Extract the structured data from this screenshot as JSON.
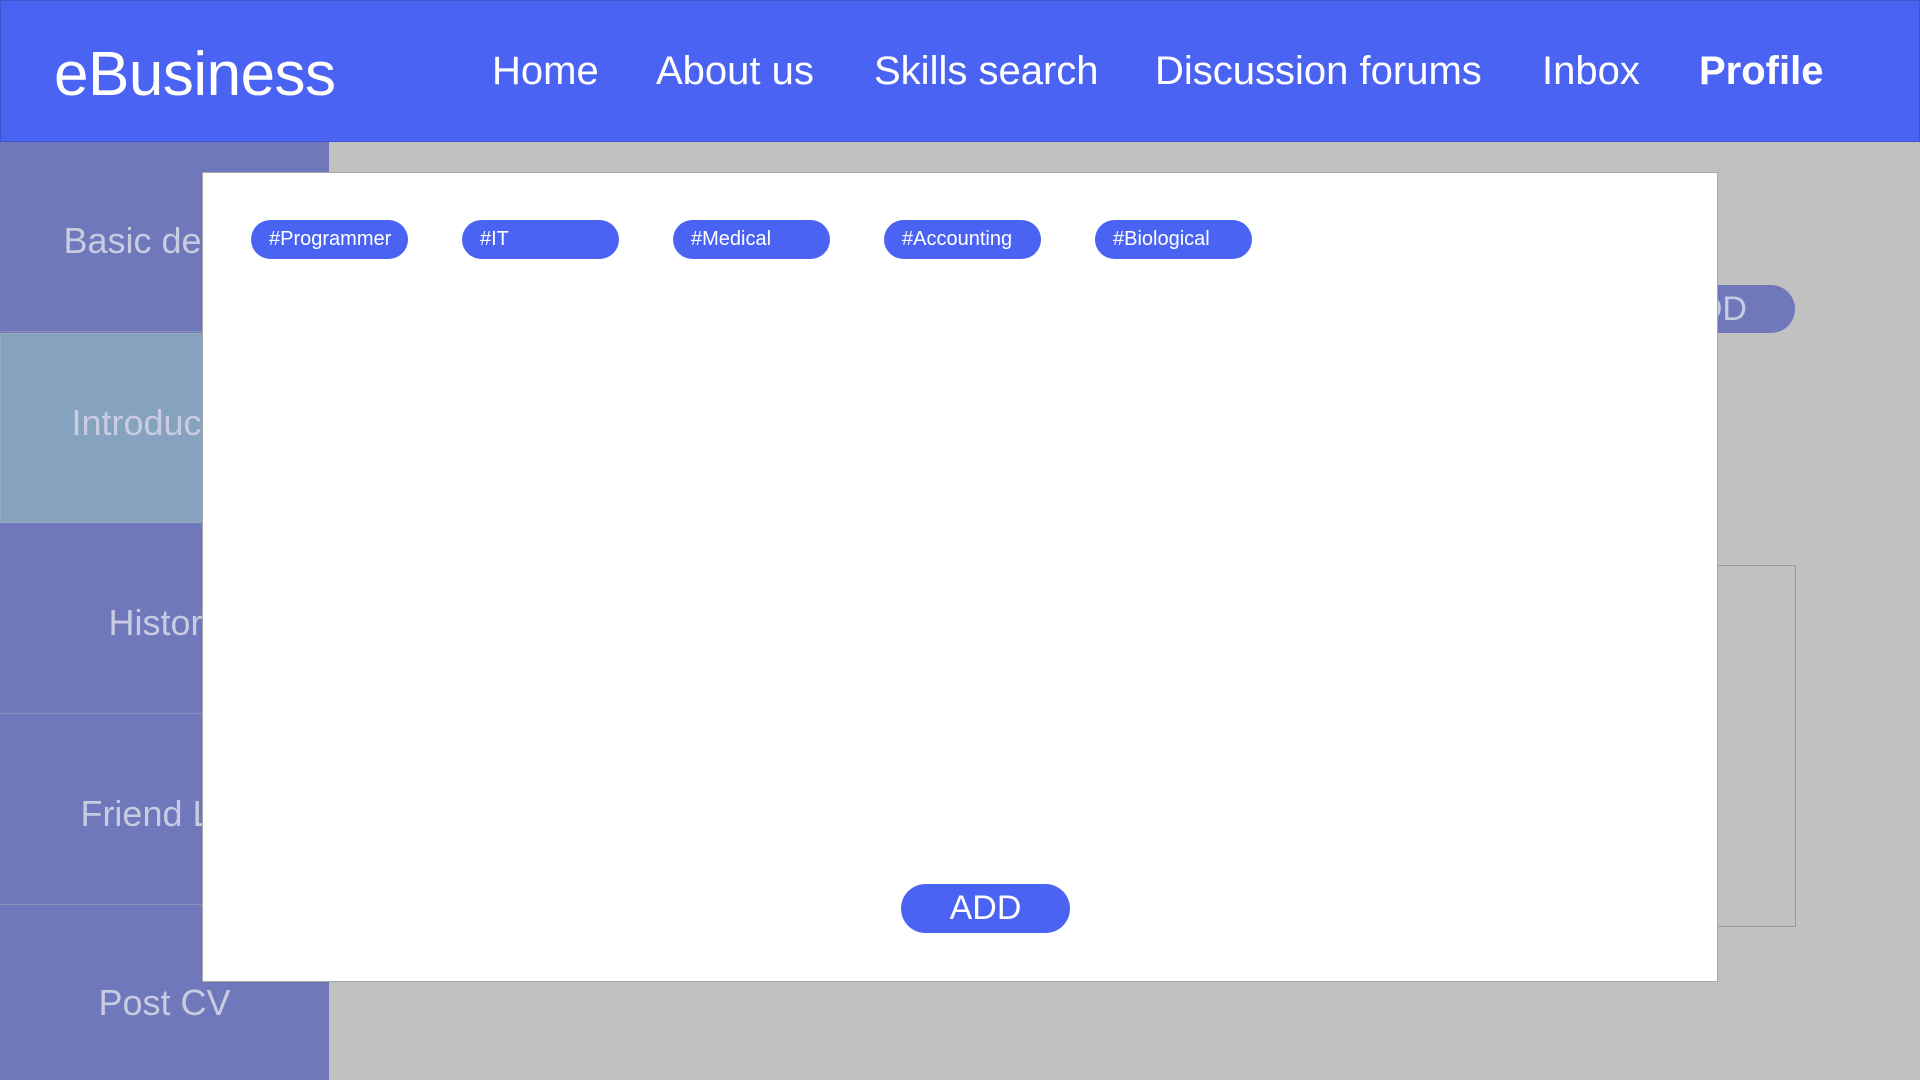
{
  "header": {
    "brand": "eBusiness",
    "nav": [
      {
        "label": "Home"
      },
      {
        "label": "About us"
      },
      {
        "label": "Skills search"
      },
      {
        "label": "Discussion forums"
      },
      {
        "label": "Inbox"
      },
      {
        "label": "Profile",
        "active": true
      }
    ]
  },
  "sidebar": {
    "items": [
      {
        "label": "Basic details"
      },
      {
        "label": "Introduction",
        "active": true
      },
      {
        "label": "History"
      },
      {
        "label": "Friend List"
      },
      {
        "label": "Post CV"
      }
    ]
  },
  "background": {
    "add_label": "ADD"
  },
  "modal": {
    "tags": [
      "#Programmer",
      "#IT",
      "#Medical",
      "#Accounting",
      "#Biological"
    ],
    "add_label": "ADD"
  },
  "colors": {
    "primary": "#4a63f2",
    "sidebar": "#6e78bb",
    "sidebar_active": "#85a3bf",
    "backdrop": "#c1c1c1"
  }
}
